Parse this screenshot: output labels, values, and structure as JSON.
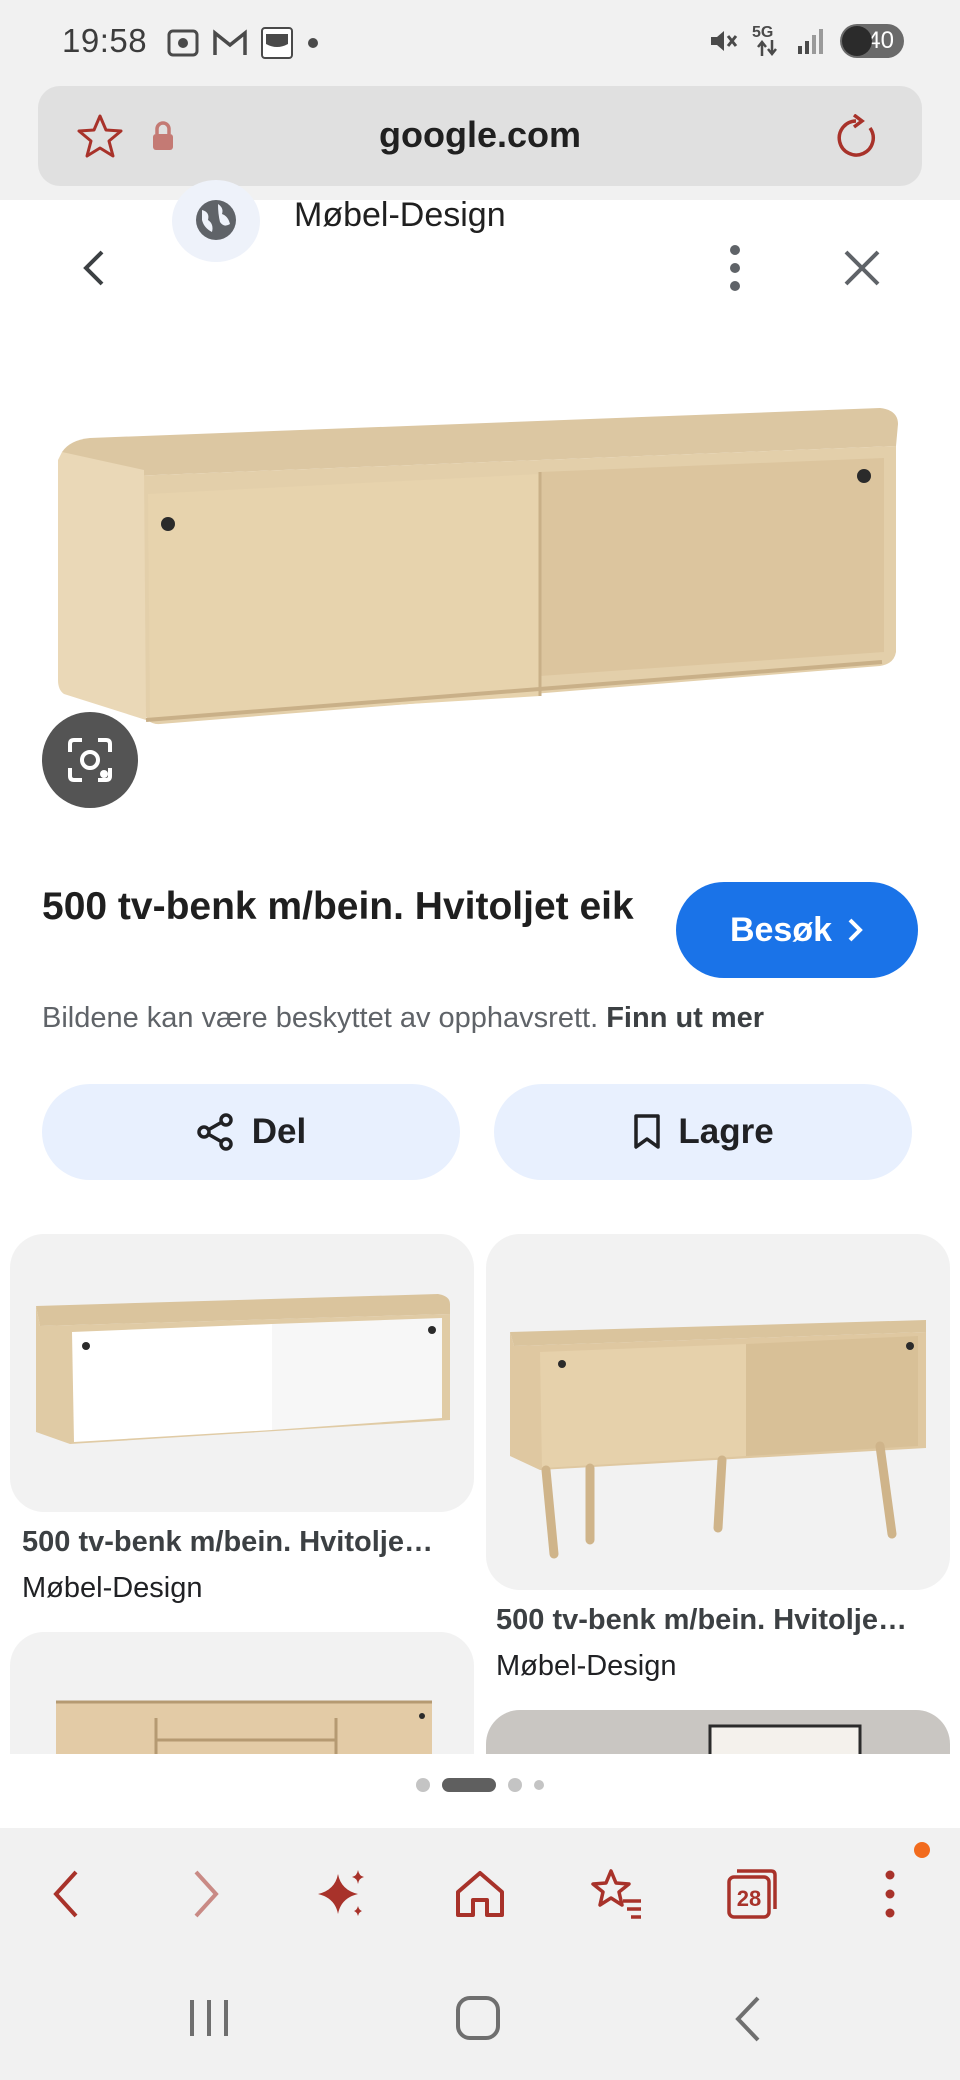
{
  "status_bar": {
    "time": "19:58",
    "network": "5G",
    "battery": "40",
    "notification_icons": [
      "screenshot-icon",
      "gmail-icon",
      "kitchen-app-icon",
      "dot-icon"
    ]
  },
  "browser": {
    "url": "google.com",
    "accent_color": "#a8322a"
  },
  "result": {
    "source_name": "Møbel-Design",
    "title": "500 tv-benk m/bein. Hvitoljet eik",
    "visit_label": "Besøk",
    "copyright_notice": "Bildene kan være beskyttet av opphavsrett.",
    "learn_more_link": "Finn ut mer",
    "share_label": "Del",
    "save_label": "Lagre",
    "visit_color": "#1a73e8"
  },
  "related": [
    {
      "title": "500 tv-benk m/bein. Hvitolje…",
      "source": "Møbel-Design"
    },
    {
      "title": "500 tv-benk m/bein. Hvitolje…",
      "source": "Møbel-Design"
    }
  ],
  "pagination": {
    "pages": 4,
    "active": 2
  }
}
